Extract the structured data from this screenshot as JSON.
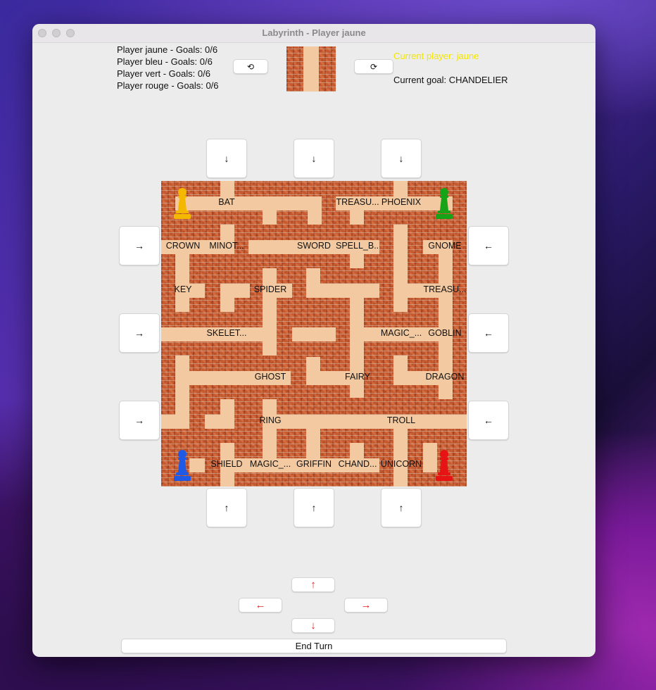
{
  "window": {
    "title": "Labyrinth - Player jaune"
  },
  "players": [
    "Player jaune - Goals: 0/6",
    "Player bleu - Goals: 0/6",
    "Player vert - Goals: 0/6",
    "Player rouge - Goals: 0/6"
  ],
  "current_player": "Current player: jaune",
  "current_goal": "Current goal: CHANDELIER",
  "colors": {
    "current_player": "#f2e600",
    "path": "#f2c9a0",
    "brick": "#c65a30",
    "arrow_red": "#e02020"
  },
  "rotate": {
    "left_icon": "⟲",
    "right_icon": "⟳"
  },
  "insert_arrows": {
    "down": "↓",
    "up": "↑",
    "right": "→",
    "left": "←"
  },
  "move": {
    "up": "↑",
    "left": "←",
    "right": "→",
    "down": "↓"
  },
  "end_turn": "End Turn",
  "tiles": {
    "r0": [
      "",
      "BAT",
      "",
      "",
      "TREASU...",
      "PHOENIX",
      ""
    ],
    "r1": [
      "CROWN",
      "MINOT...",
      "",
      "SWORD",
      "SPELL_B...",
      "",
      "GNOME"
    ],
    "r2": [
      "KEY",
      "",
      "SPIDER",
      "",
      "",
      "",
      "TREASU..."
    ],
    "r3": [
      "",
      "SKELET...",
      "",
      "",
      "",
      "MAGIC_...",
      "GOBLIN"
    ],
    "r4": [
      "",
      "",
      "GHOST",
      "",
      "FAIRY",
      "",
      "DRAGON"
    ],
    "r5": [
      "",
      "",
      "RING",
      "",
      "",
      "TROLL",
      ""
    ],
    "r6": [
      "",
      "SHIELD",
      "MAGIC_...",
      "GRIFFIN",
      "CHAND...",
      "UNICORN",
      ""
    ]
  },
  "pawns": [
    {
      "color": "#f5b800",
      "name": "jaune"
    },
    {
      "color": "#17a317",
      "name": "vert"
    },
    {
      "color": "#1e5ae6",
      "name": "bleu"
    },
    {
      "color": "#e61414",
      "name": "rouge"
    }
  ]
}
